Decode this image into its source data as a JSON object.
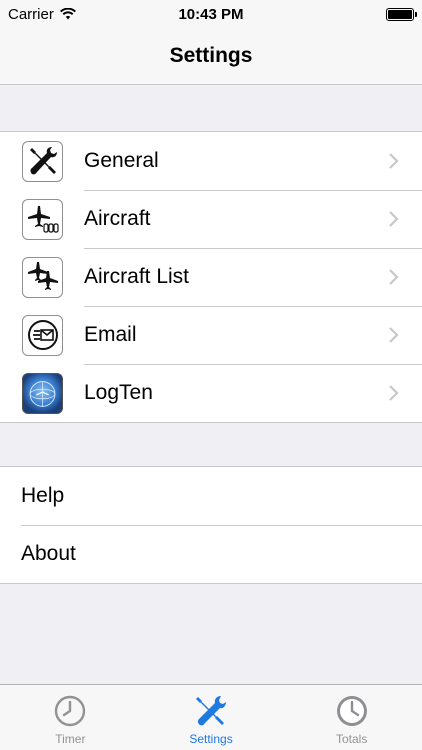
{
  "status_bar": {
    "carrier": "Carrier",
    "time": "10:43 PM"
  },
  "nav": {
    "title": "Settings"
  },
  "group1": {
    "items": [
      {
        "label": "General",
        "icon": "wrench-screwdriver-icon"
      },
      {
        "label": "Aircraft",
        "icon": "airplane-gauges-icon"
      },
      {
        "label": "Aircraft List",
        "icon": "airplanes-icon"
      },
      {
        "label": "Email",
        "icon": "email-icon"
      },
      {
        "label": "LogTen",
        "icon": "logten-globe-icon"
      }
    ]
  },
  "group2": {
    "items": [
      {
        "label": "Help"
      },
      {
        "label": "About"
      }
    ]
  },
  "tabs": [
    {
      "label": "Timer",
      "icon": "clock-icon",
      "active": false
    },
    {
      "label": "Settings",
      "icon": "tools-icon",
      "active": true
    },
    {
      "label": "Totals",
      "icon": "clock-dark-icon",
      "active": false
    }
  ],
  "colors": {
    "accent": "#1f7ae0",
    "background": "#efeff4",
    "separator": "#c8c7cc",
    "inactive_tab": "#929292"
  }
}
